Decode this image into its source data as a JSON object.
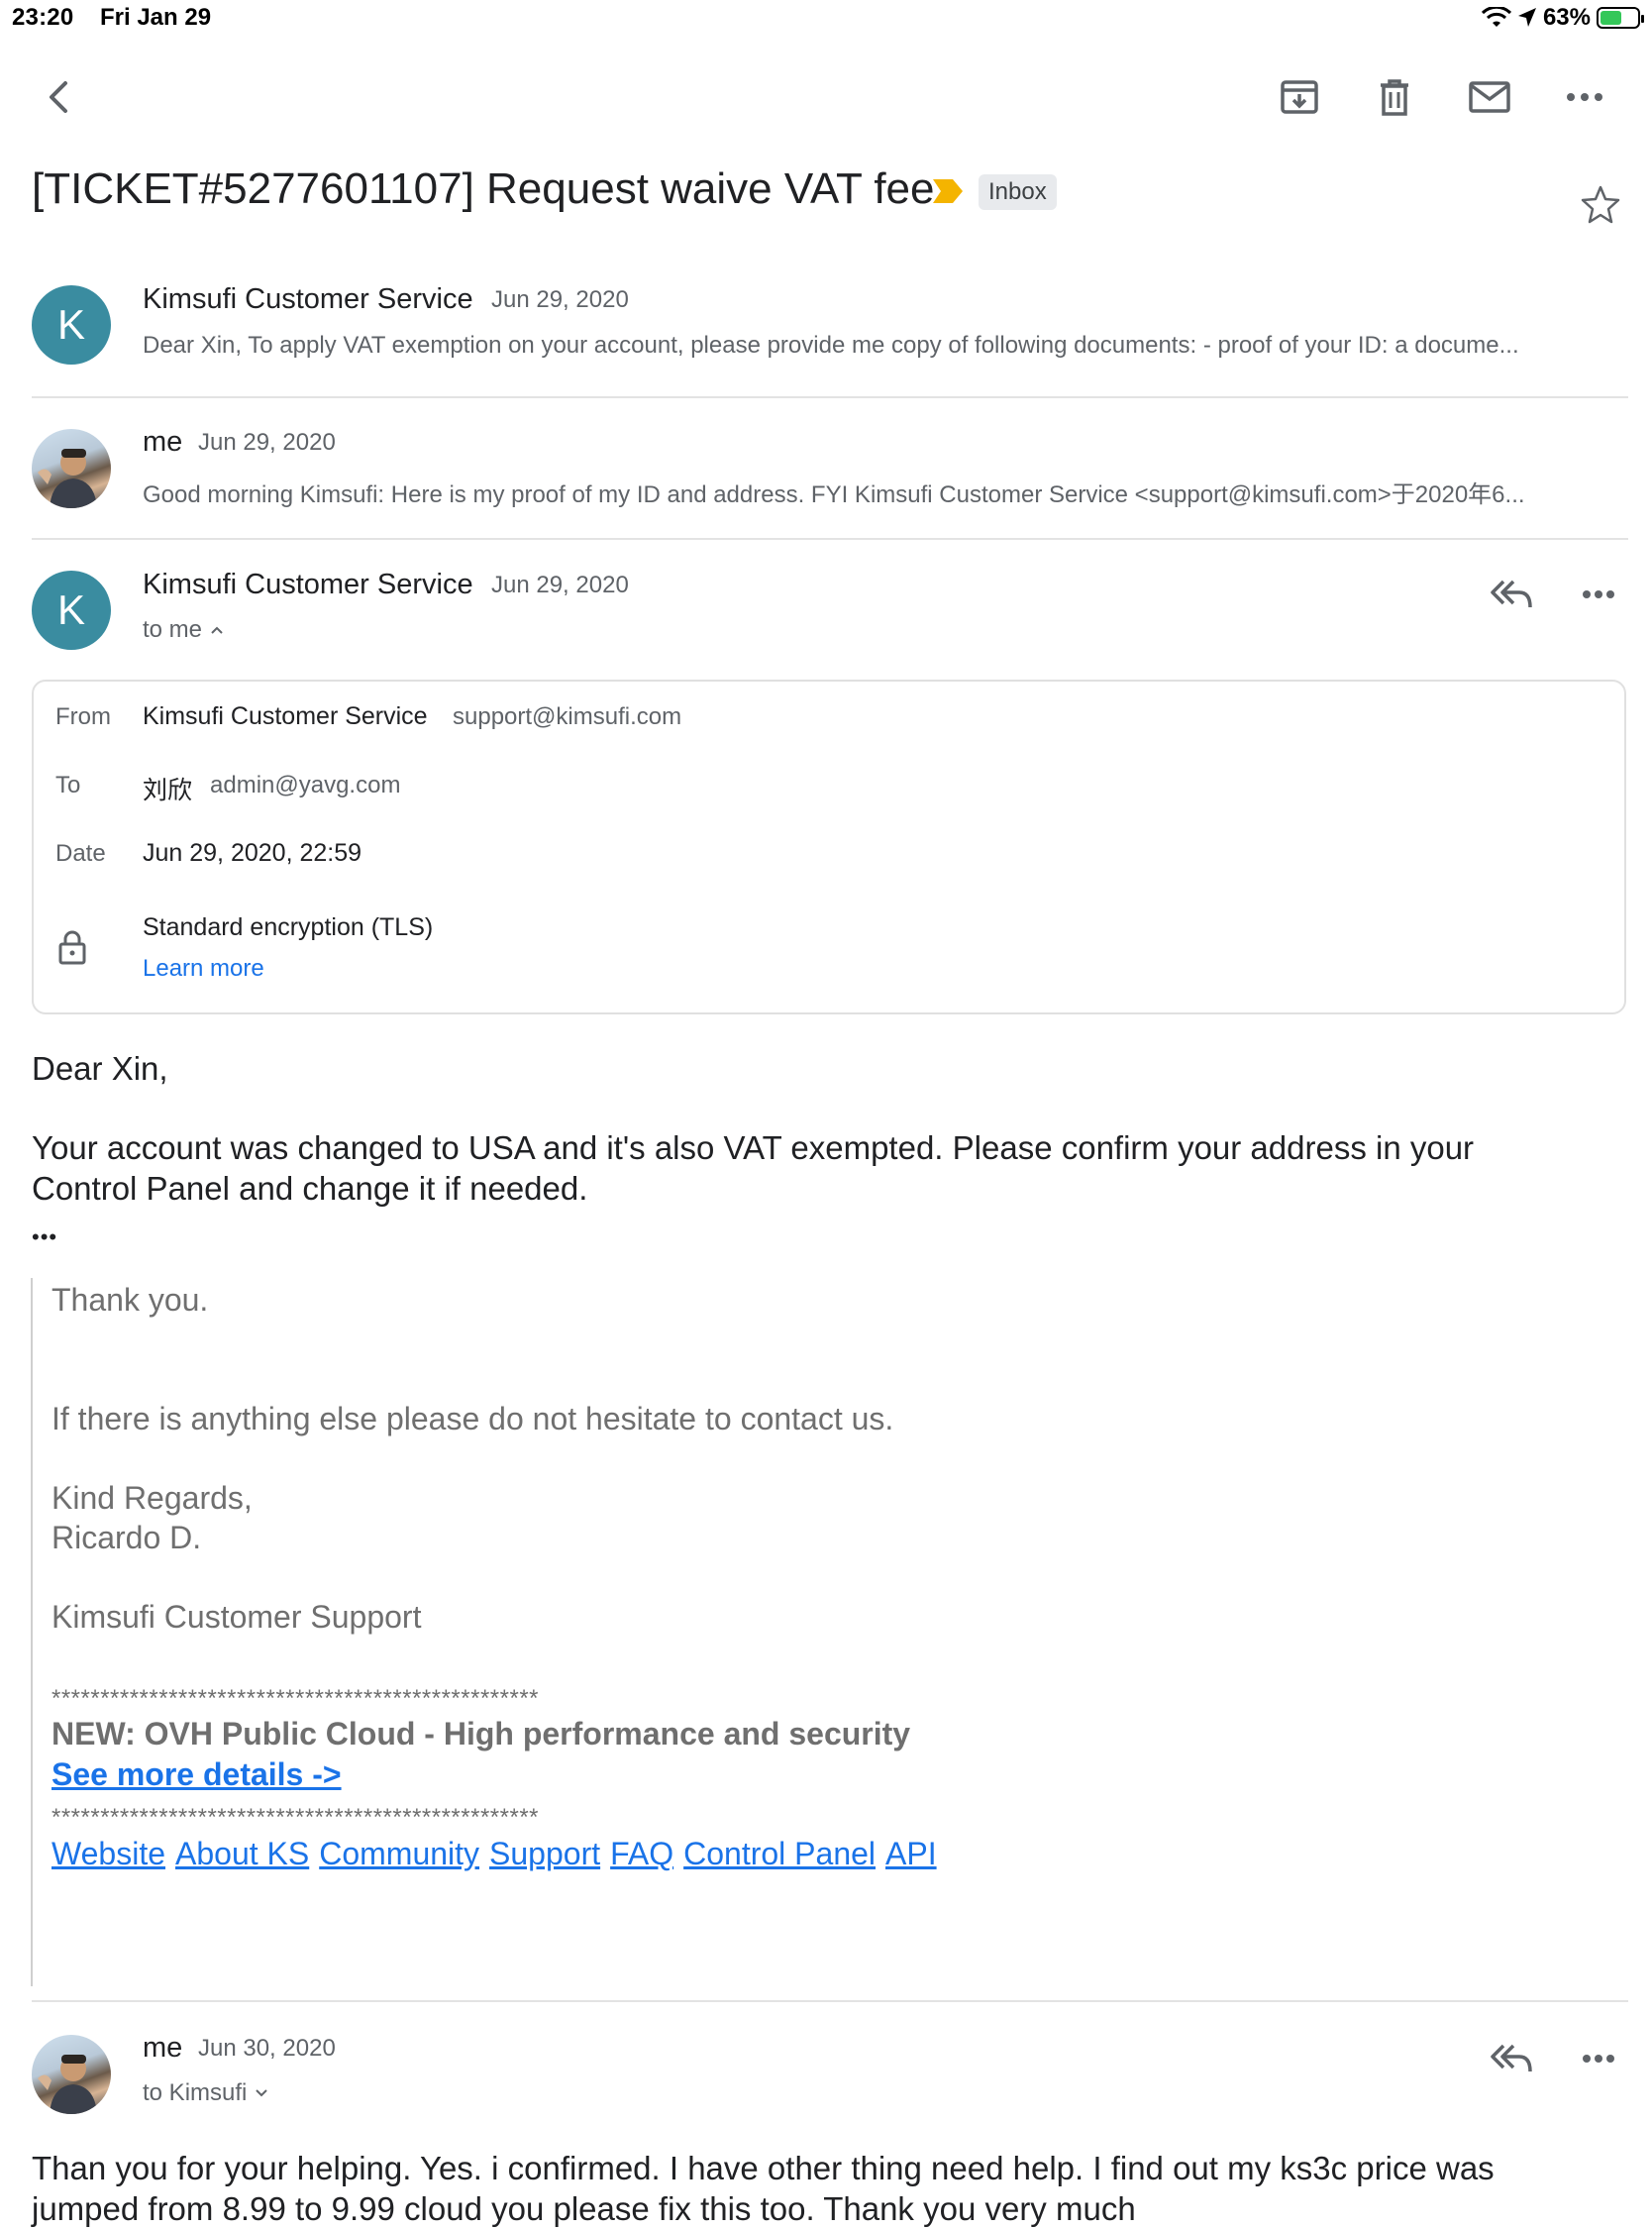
{
  "status_bar": {
    "time": "23:20",
    "date": "Fri Jan 29",
    "battery": "63%",
    "battery_level": 0.63
  },
  "toolbar": {
    "back_icon": "back-arrow-icon",
    "archive_icon": "archive-icon",
    "delete_icon": "trash-icon",
    "mark_unread_icon": "mail-icon",
    "more_icon": "more-horizontal-icon"
  },
  "subject": {
    "text": "[TICKET#5277601107] Request waive VAT fee",
    "label": "Inbox",
    "label_color": "#f4b400"
  },
  "messages": [
    {
      "sender": "Kimsufi Customer Service",
      "avatar": "K",
      "date": "Jun 29, 2020",
      "snippet": "Dear Xin, To apply VAT exemption on your account, please provide me copy of following documents: - proof of your ID: a docume..."
    },
    {
      "sender": "me",
      "date": "Jun 29, 2020",
      "snippet": "Good morning Kimsufi: Here is my proof of my ID and address. FYI Kimsufi Customer Service <support@kimsufi.com>于2020年6..."
    }
  ],
  "expanded": {
    "sender": "Kimsufi Customer Service",
    "avatar": "K",
    "date": "Jun 29, 2020",
    "to_me": "to me",
    "details": {
      "from_label": "From",
      "from_name": "Kimsufi Customer Service",
      "from_email": "support@kimsufi.com",
      "to_label": "To",
      "to_name": "刘欣",
      "to_email": "admin@yavg.com",
      "date_label": "Date",
      "date_value": "Jun 29, 2020, 22:59",
      "encryption": "Standard encryption (TLS)",
      "learn_more": "Learn more"
    },
    "greeting": "Dear Xin,",
    "body_line1": "Your account was changed to USA and it's also VAT exempted. Please confirm your address in your",
    "body_line2": "Control Panel and change it if needed.",
    "ellipsis": "•••",
    "quoted": {
      "thanks": "Thank you.",
      "contact": "If there is anything else please do not hesitate to contact us.",
      "regards": "Kind Regards,",
      "name": "Ricardo D.",
      "team": "Kimsufi Customer Support",
      "stars": "**************************************************",
      "promo": "NEW: OVH Public Cloud - High performance and security",
      "promo_link": "See more details ->",
      "links": [
        "Website",
        "About KS",
        "Community",
        "Support",
        "FAQ",
        "Control Panel",
        "API"
      ]
    }
  },
  "reply": {
    "sender": "me",
    "date": "Jun 30, 2020",
    "to": "to Kimsufi",
    "body_line1": "Than you for your helping. Yes. i confirmed. I have other thing need help. I find out my ks3c price was",
    "body_line2": "jumped from 8.99 to 9.99 cloud you please fix this too. Thank you very much"
  }
}
